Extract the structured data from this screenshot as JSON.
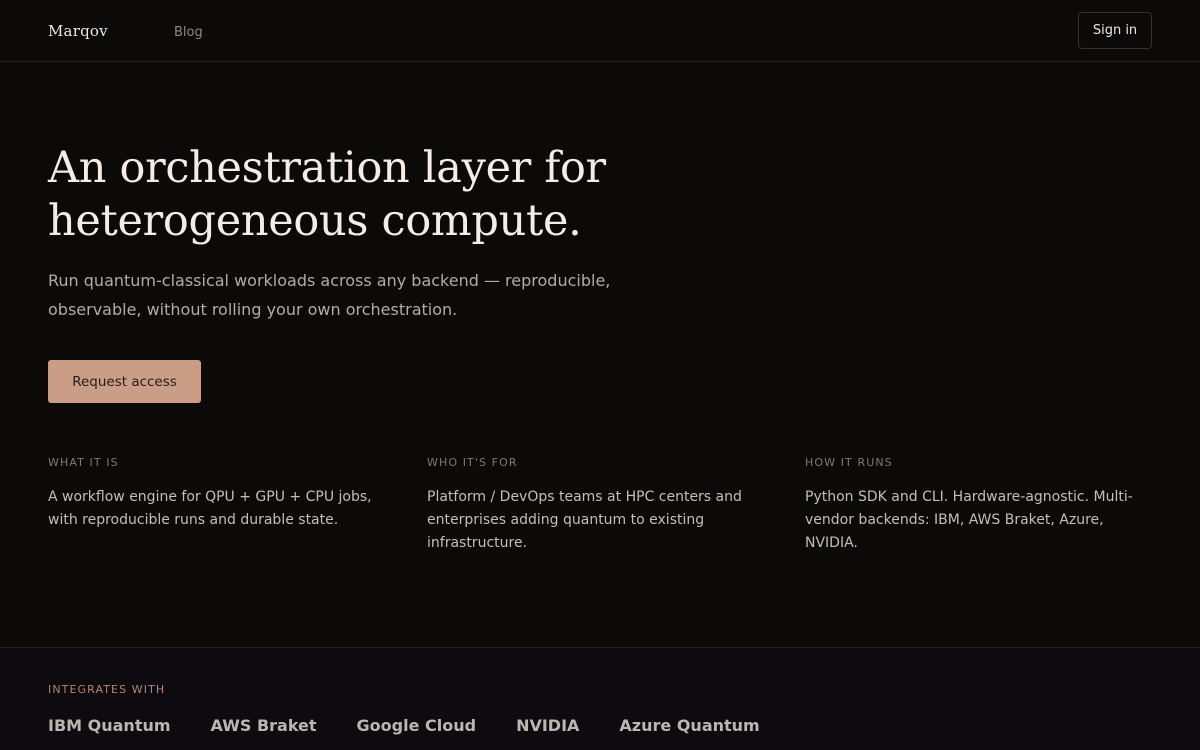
{
  "header": {
    "logo": "Marqov",
    "nav": {
      "blog": "Blog"
    },
    "signin_label": "Sign in"
  },
  "hero": {
    "headline_line1": "An orchestration layer for",
    "headline_line2": "heterogeneous compute.",
    "subhead": "Run quantum-classical workloads across any backend — reproducible, observable, without rolling your own orchestration.",
    "cta_label": "Request access"
  },
  "features": [
    {
      "label": "WHAT IT IS",
      "text": "A workflow engine for QPU + GPU + CPU jobs, with reproducible runs and durable state."
    },
    {
      "label": "WHO IT'S FOR",
      "text": "Platform / DevOps teams at HPC centers and enterprises adding quantum to existing infrastructure."
    },
    {
      "label": "HOW IT RUNS",
      "text": "Python SDK and CLI. Hardware-agnostic. Multi-vendor backends: IBM, AWS Braket, Azure, NVIDIA."
    }
  ],
  "integrations": {
    "label": "INTEGRATES WITH",
    "items": [
      "IBM Quantum",
      "AWS Braket",
      "Google Cloud",
      "NVIDIA",
      "Azure Quantum"
    ]
  },
  "colors": {
    "background": "#0c0a09",
    "accent": "#c99d86",
    "integrations_label": "#b5856d"
  }
}
